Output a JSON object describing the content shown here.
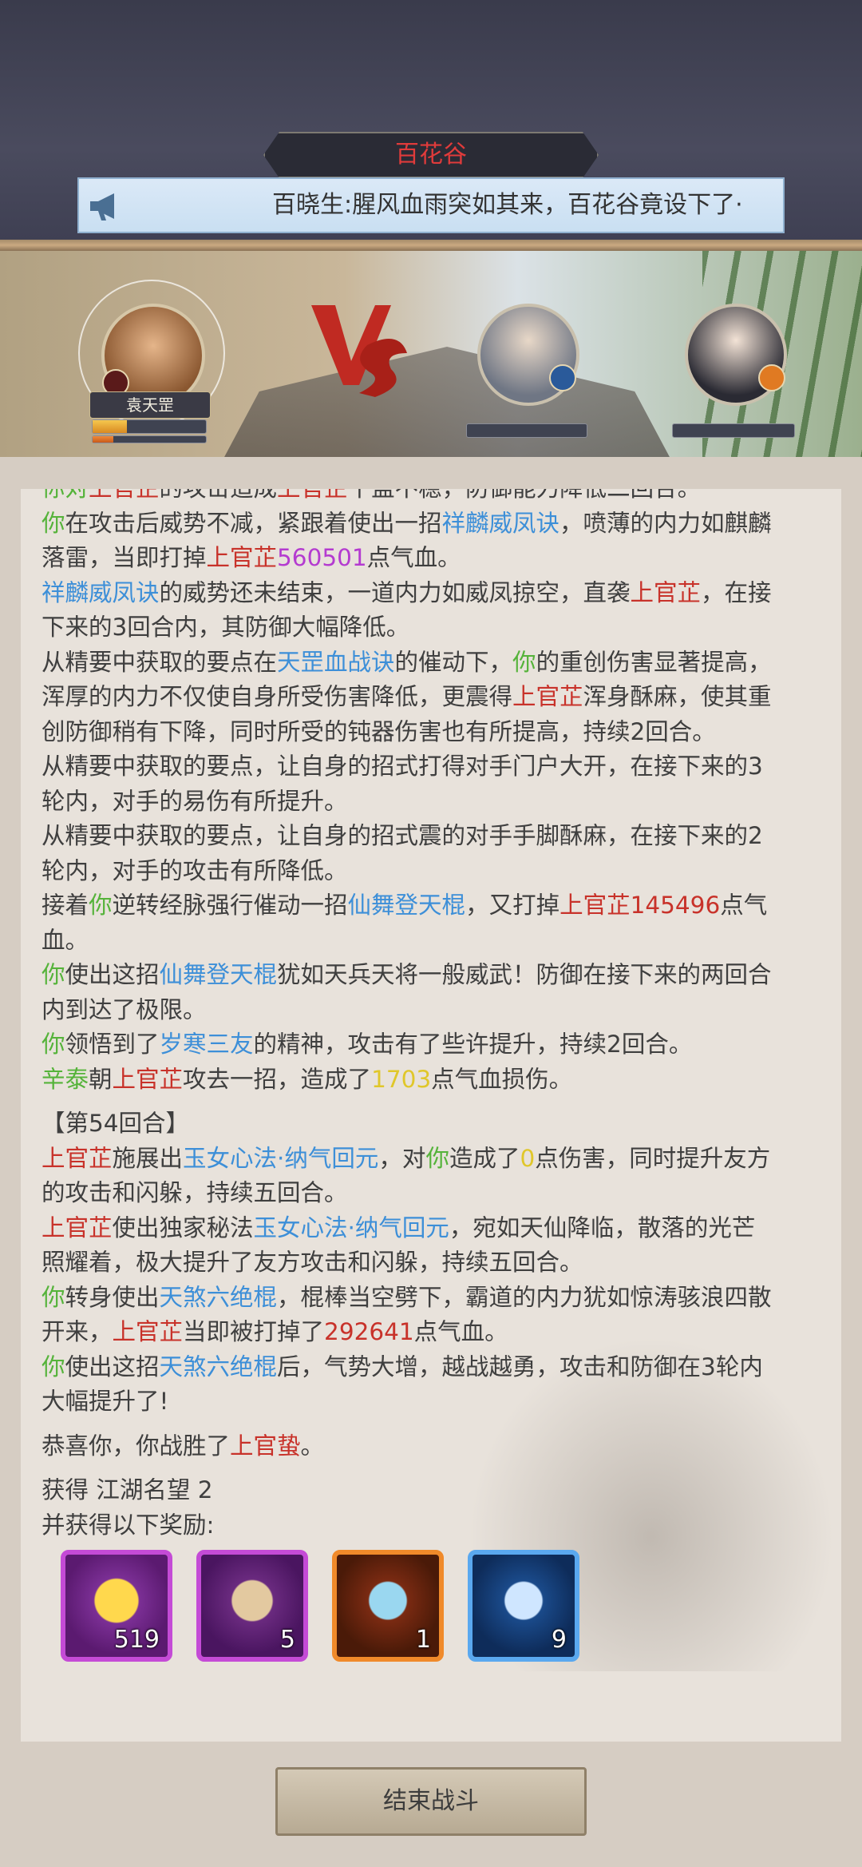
{
  "header": {
    "location": "百花谷",
    "announcement": "百晓生:腥风血雨突如其来，百花谷竟设下了·"
  },
  "battle": {
    "hero_name": "袁天罡",
    "hero_hp": 0.3,
    "hero_mp": 0.18,
    "vs_icon": "vs-emblem-icon"
  },
  "log": [
    [
      {
        "t": "你对",
        "c": "g"
      },
      {
        "t": "上官芷",
        "c": "r"
      },
      {
        "t": "的攻击造成",
        "c": ""
      },
      {
        "t": "上官芷",
        "c": "r"
      },
      {
        "t": "十盖不稳，防御能力降低二回合。",
        "c": ""
      }
    ],
    [
      {
        "t": "你",
        "c": "g"
      },
      {
        "t": "在攻击后威势不减，紧跟着使出一招",
        "c": ""
      },
      {
        "t": "祥麟威凤诀",
        "c": "b"
      },
      {
        "t": "，喷薄的内力如麒麟",
        "c": ""
      }
    ],
    [
      {
        "t": "落雷，当即打掉",
        "c": ""
      },
      {
        "t": "上官芷",
        "c": "r"
      },
      {
        "t": "560501",
        "c": "p"
      },
      {
        "t": "点气血。",
        "c": ""
      }
    ],
    [
      {
        "t": "祥麟威凤诀",
        "c": "b"
      },
      {
        "t": "的威势还未结束，一道内力如威凤掠空，直袭",
        "c": ""
      },
      {
        "t": "上官芷",
        "c": "r"
      },
      {
        "t": "，在接",
        "c": ""
      }
    ],
    [
      {
        "t": "下来的3回合内，其防御大幅降低。",
        "c": ""
      }
    ],
    [
      {
        "t": "从精要中获取的要点在",
        "c": ""
      },
      {
        "t": "天罡血战诀",
        "c": "b"
      },
      {
        "t": "的催动下，",
        "c": ""
      },
      {
        "t": "你",
        "c": "g"
      },
      {
        "t": "的重创伤害显著提高，",
        "c": ""
      }
    ],
    [
      {
        "t": "浑厚的内力不仅使自身所受伤害降低，更震得",
        "c": ""
      },
      {
        "t": "上官芷",
        "c": "r"
      },
      {
        "t": "浑身酥麻，使其重",
        "c": ""
      }
    ],
    [
      {
        "t": "创防御稍有下降，同时所受的钝器伤害也有所提高，持续2回合。",
        "c": ""
      }
    ],
    [
      {
        "t": "从精要中获取的要点，让自身的招式打得对手门户大开，在接下来的3",
        "c": ""
      }
    ],
    [
      {
        "t": "轮内，对手的易伤有所提升。",
        "c": ""
      }
    ],
    [
      {
        "t": "从精要中获取的要点，让自身的招式震的对手手脚酥麻，在接下来的2",
        "c": ""
      }
    ],
    [
      {
        "t": "轮内，对手的攻击有所降低。",
        "c": ""
      }
    ],
    [
      {
        "t": "接着",
        "c": ""
      },
      {
        "t": "你",
        "c": "g"
      },
      {
        "t": "逆转经脉强行催动一招",
        "c": ""
      },
      {
        "t": "仙舞登天棍",
        "c": "b"
      },
      {
        "t": "，又打掉",
        "c": ""
      },
      {
        "t": "上官芷",
        "c": "r"
      },
      {
        "t": "145496",
        "c": "r"
      },
      {
        "t": "点气",
        "c": ""
      }
    ],
    [
      {
        "t": "血。",
        "c": ""
      }
    ],
    [
      {
        "t": "你",
        "c": "g"
      },
      {
        "t": "使出这招",
        "c": ""
      },
      {
        "t": "仙舞登天棍",
        "c": "b"
      },
      {
        "t": "犹如天兵天将一般威武！防御在接下来的两回合",
        "c": ""
      }
    ],
    [
      {
        "t": "内到达了极限。",
        "c": ""
      }
    ],
    [
      {
        "t": "你",
        "c": "g"
      },
      {
        "t": "领悟到了",
        "c": ""
      },
      {
        "t": "岁寒三友",
        "c": "b"
      },
      {
        "t": "的精神，攻击有了些许提升，持续2回合。",
        "c": ""
      }
    ],
    [
      {
        "t": "辛泰",
        "c": "g"
      },
      {
        "t": "朝",
        "c": ""
      },
      {
        "t": "上官芷",
        "c": "r"
      },
      {
        "t": "攻去一招，造成了",
        "c": ""
      },
      {
        "t": "1703",
        "c": "y"
      },
      {
        "t": "点气血损伤。",
        "c": ""
      }
    ],
    "GAP",
    [
      {
        "t": "【第54回合】",
        "c": ""
      }
    ],
    [
      {
        "t": "上官芷",
        "c": "r"
      },
      {
        "t": "施展出",
        "c": ""
      },
      {
        "t": "玉女心法·纳气回元",
        "c": "b"
      },
      {
        "t": "，对",
        "c": ""
      },
      {
        "t": "你",
        "c": "g"
      },
      {
        "t": "造成了",
        "c": ""
      },
      {
        "t": "0",
        "c": "y"
      },
      {
        "t": "点伤害，同时提升友方",
        "c": ""
      }
    ],
    [
      {
        "t": "的攻击和闪躲，持续五回合。",
        "c": ""
      }
    ],
    [
      {
        "t": "上官芷",
        "c": "r"
      },
      {
        "t": "使出独家秘法",
        "c": ""
      },
      {
        "t": "玉女心法·纳气回元",
        "c": "b"
      },
      {
        "t": "，宛如天仙降临，散落的光芒",
        "c": ""
      }
    ],
    [
      {
        "t": "照耀着，极大提升了友方攻击和闪躲，持续五回合。",
        "c": ""
      }
    ],
    [
      {
        "t": "你",
        "c": "g"
      },
      {
        "t": "转身使出",
        "c": ""
      },
      {
        "t": "天煞六绝棍",
        "c": "b"
      },
      {
        "t": "，棍棒当空劈下，霸道的内力犹如惊涛骇浪四散",
        "c": ""
      }
    ],
    [
      {
        "t": "开来，",
        "c": ""
      },
      {
        "t": "上官芷",
        "c": "r"
      },
      {
        "t": "当即被打掉了",
        "c": ""
      },
      {
        "t": "292641",
        "c": "r"
      },
      {
        "t": "点气血。",
        "c": ""
      }
    ],
    [
      {
        "t": "你",
        "c": "g"
      },
      {
        "t": "使出这招",
        "c": ""
      },
      {
        "t": "天煞六绝棍",
        "c": "b"
      },
      {
        "t": "后，气势大增，越战越勇，攻击和防御在3轮内",
        "c": ""
      }
    ],
    [
      {
        "t": "大幅提升了!",
        "c": ""
      }
    ],
    "GAP",
    [
      {
        "t": "恭喜你，你战胜了",
        "c": ""
      },
      {
        "t": "上官蛰",
        "c": "r"
      },
      {
        "t": "。",
        "c": ""
      }
    ],
    "GAP",
    [
      {
        "t": "获得 江湖名望 2",
        "c": ""
      }
    ],
    [
      {
        "t": "并获得以下奖励:",
        "c": ""
      }
    ]
  ],
  "rewards": [
    {
      "icon": "gold-ingot-icon",
      "count": "519"
    },
    {
      "icon": "treasure-pouch-icon",
      "count": "5"
    },
    {
      "icon": "cyan-cloud-icon",
      "count": "1"
    },
    {
      "icon": "ice-crystal-icon",
      "count": "9"
    }
  ],
  "footer": {
    "end_button": "结束战斗"
  },
  "colors": {
    "green": "#55b33a",
    "red": "#c8322a",
    "blue": "#3d8fd8",
    "purple": "#b43bd0",
    "yellow": "#e0c72a"
  }
}
